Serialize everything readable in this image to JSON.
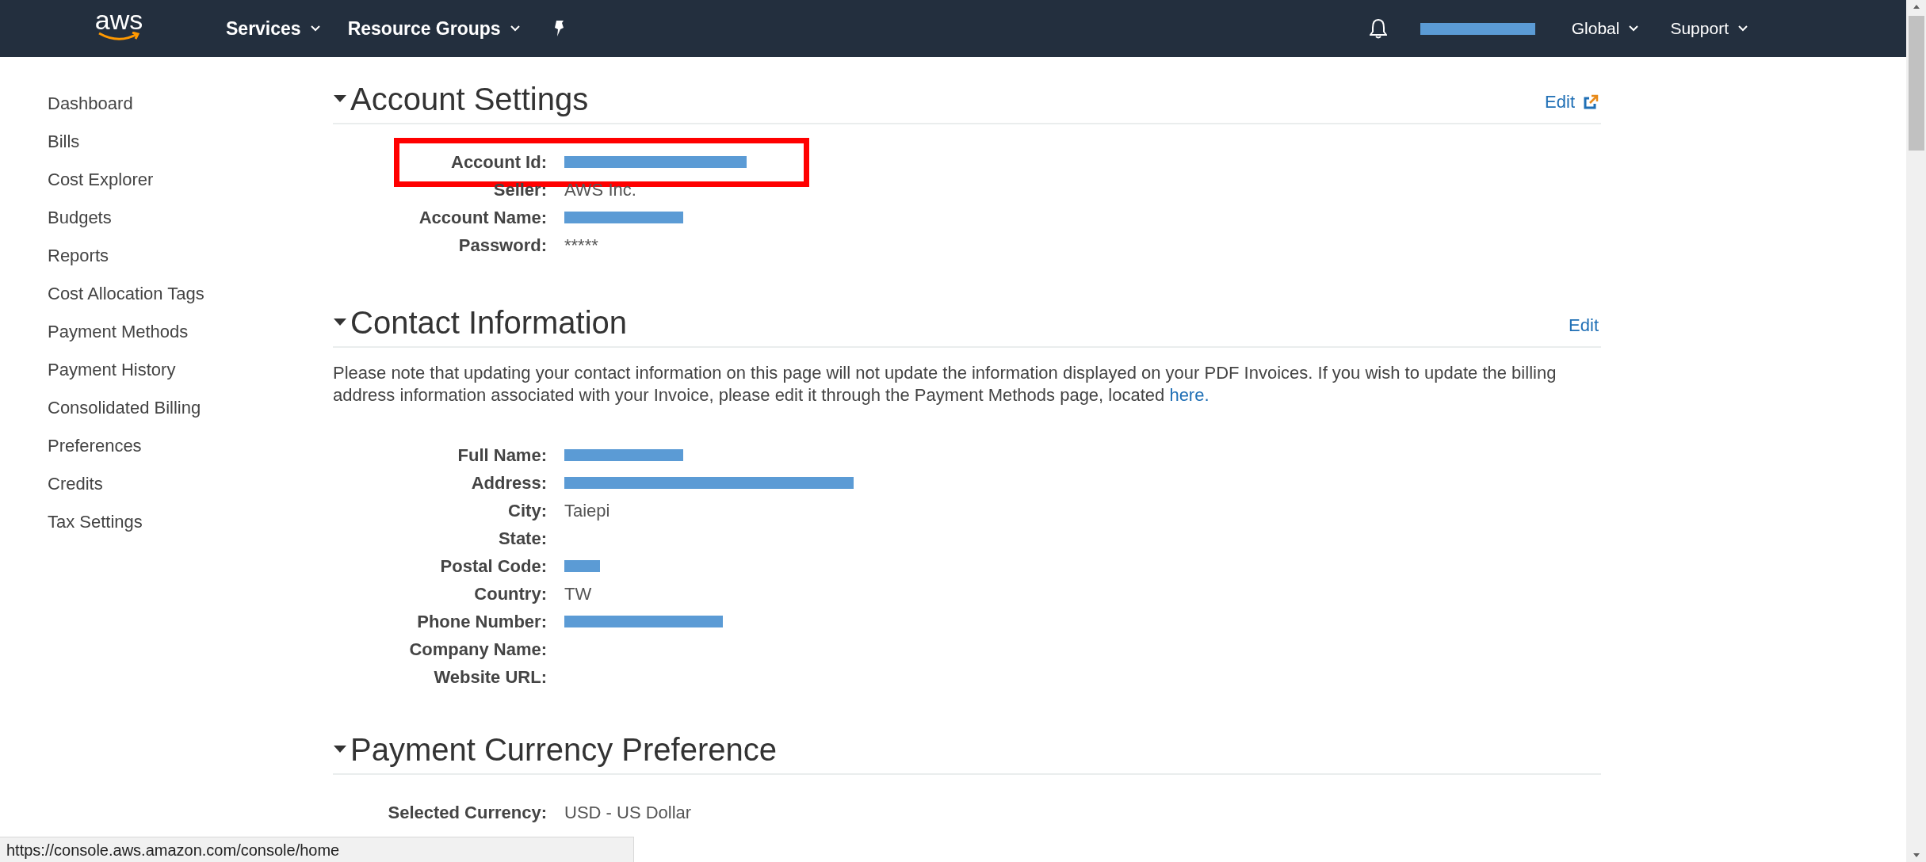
{
  "top_nav": {
    "logo": "aws",
    "menus": [
      {
        "label": "Services"
      },
      {
        "label": "Resource Groups"
      }
    ],
    "user": {
      "redacted": true
    },
    "right_menus": [
      {
        "label": "Global"
      },
      {
        "label": "Support"
      }
    ]
  },
  "sidebar": {
    "items": [
      {
        "label": "Dashboard"
      },
      {
        "label": "Bills"
      },
      {
        "label": "Cost Explorer"
      },
      {
        "label": "Budgets"
      },
      {
        "label": "Reports"
      },
      {
        "label": "Cost Allocation Tags"
      },
      {
        "label": "Payment Methods"
      },
      {
        "label": "Payment History"
      },
      {
        "label": "Consolidated Billing"
      },
      {
        "label": "Preferences"
      },
      {
        "label": "Credits"
      },
      {
        "label": "Tax Settings"
      }
    ]
  },
  "sections": [
    {
      "title": "Account Settings",
      "edit": {
        "label": "Edit",
        "external": true
      },
      "fields": [
        {
          "label": "Account Id:",
          "redacted": true,
          "highlighted": true
        },
        {
          "label": "Seller:",
          "value": "AWS Inc.",
          "redacted": false,
          "highlighted": false
        },
        {
          "label": "Account Name:",
          "redacted": true,
          "highlighted": false
        },
        {
          "label": "Password:",
          "value": "*****",
          "redacted": false,
          "highlighted": false
        }
      ]
    },
    {
      "title": "Contact Information",
      "edit": {
        "label": "Edit",
        "external": false
      },
      "note": {
        "text": "Please note that updating your contact information on this page will not update the information displayed on your PDF Invoices. If you wish to update the billing address information associated with your Invoice, please edit it through the Payment Methods page, located ",
        "link": "here."
      },
      "fields": [
        {
          "label": "Full Name:",
          "redacted": true,
          "highlighted": false
        },
        {
          "label": "Address:",
          "redacted": true,
          "highlighted": false
        },
        {
          "label": "City:",
          "value": "Taiepi",
          "redacted": false,
          "highlighted": false
        },
        {
          "label": "State:",
          "redacted": false,
          "highlighted": false
        },
        {
          "label": "Postal Code:",
          "redacted": true,
          "highlighted": false
        },
        {
          "label": "Country:",
          "value": "TW",
          "redacted": false,
          "highlighted": false
        },
        {
          "label": "Phone Number:",
          "redacted": true,
          "highlighted": false
        },
        {
          "label": "Company Name:",
          "redacted": false,
          "highlighted": false
        },
        {
          "label": "Website URL:",
          "redacted": false,
          "highlighted": false
        }
      ]
    },
    {
      "title": "Payment Currency Preference",
      "fields": [
        {
          "label": "Selected Currency:",
          "value": "USD - US Dollar",
          "redacted": false,
          "highlighted": false
        }
      ]
    }
  ],
  "status_bar": {
    "url": "https://console.aws.amazon.com/console/home"
  }
}
